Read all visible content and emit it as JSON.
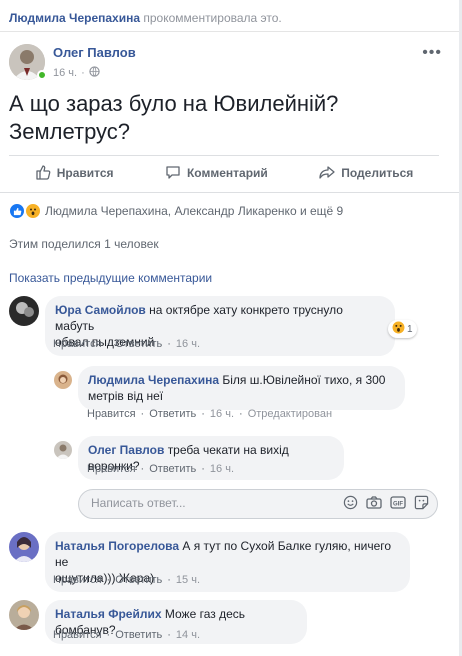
{
  "activity": {
    "name": "Людмила Черепахина",
    "text": "прокомментировала это."
  },
  "post": {
    "author": "Олег Павлов",
    "time": "16 ч.",
    "text_line1": "А що зараз було на Ювилейній?",
    "text_line2": "Землетрус?"
  },
  "actions": {
    "like": "Нравится",
    "comment": "Комментарий",
    "share": "Поделиться"
  },
  "reactions_summary": "Людмила Черепахина, Александр Ликаренко и ещё 9",
  "shares_text": "Этим поделился 1 человек",
  "show_previous": "Показать предыдущие комментарии",
  "comment_action_labels": {
    "like": "Нравится",
    "reply": "Ответить",
    "dot": "·"
  },
  "comments": [
    {
      "author": "Юра Самойлов",
      "line1": "на октябре хату конкрето труснуло мабуть",
      "line2": "обвал пыдземний",
      "time": "16 ч.",
      "reaction_count": "1"
    },
    {
      "author": "Людмила Черепахина",
      "line1": "Біля ш.Ювілейної тихо, я 300",
      "line2": "метрів від неї",
      "time": "16 ч.",
      "edited": "Отредактирован"
    },
    {
      "author": "Олег Павлов",
      "line1": "треба чекати на вихід воронки?",
      "time": "16 ч."
    },
    {
      "author": "Наталья Погорелова",
      "line1": "А я тут по Сухой Балке гуляю, ничего не",
      "line2": "ощутила))) Жара)",
      "time": "15 ч."
    },
    {
      "author": "Наталья Фрейлих",
      "line1": "Може газ десь бомбанув?",
      "time": "14 ч."
    }
  ],
  "reply": {
    "placeholder": "Написать ответ..."
  },
  "colors": {
    "link": "#385898",
    "bubble": "#f2f3f5",
    "online": "#42b72a",
    "like": "#1877f2",
    "wow": "#f7b125"
  }
}
